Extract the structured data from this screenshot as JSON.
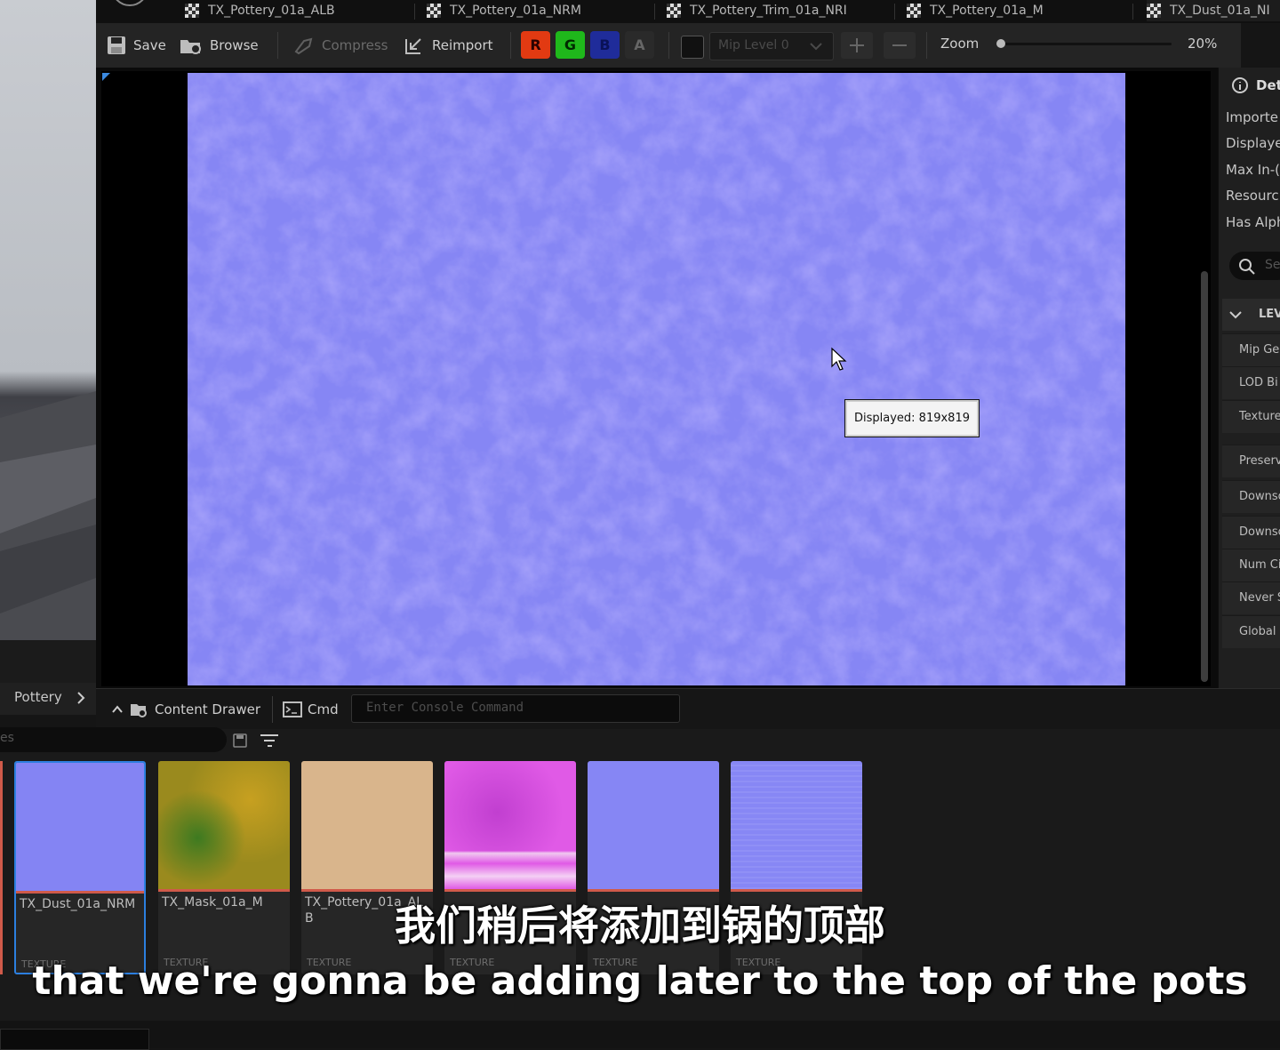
{
  "tabs": [
    {
      "label": "TX_Pottery_01a_ALB"
    },
    {
      "label": "TX_Pottery_01a_NRM"
    },
    {
      "label": "TX_Pottery_Trim_01a_NRI"
    },
    {
      "label": "TX_Pottery_01a_M"
    },
    {
      "label": "TX_Dust_01a_NI"
    }
  ],
  "toolbar": {
    "save": "Save",
    "browse": "Browse",
    "compress": "Compress",
    "reimport": "Reimport",
    "channels": [
      "R",
      "G",
      "B",
      "A"
    ],
    "mip_level": "Mip Level 0",
    "zoom_label": "Zoom",
    "zoom_value": "20%",
    "zoom_fraction": 0.02
  },
  "viewport": {
    "tooltip": "Displayed: 819x819"
  },
  "details": {
    "title": "Det",
    "rows": [
      "Importe",
      "Displaye",
      "Max In-(",
      "Resourc",
      "Has Alph"
    ],
    "search_placeholder": "Se",
    "section": "LEV",
    "lev_rows": [
      "Mip Ge",
      "LOD Bi",
      "Texture",
      "Preserv",
      "Downsc",
      "Downsc",
      "Num Ci",
      "Never S",
      "Global I"
    ]
  },
  "left_panel": {
    "folder": "Pottery"
  },
  "bottom_bar": {
    "content_drawer": "Content Drawer",
    "cmd": "Cmd",
    "console_placeholder": "Enter Console Command"
  },
  "content_browser": {
    "search_fragment": "es",
    "assets": [
      {
        "name": "TX_Dust_01a_NRM",
        "type": "TEXTURE",
        "selected": true,
        "color": "#8484f3"
      },
      {
        "name": "TX_Mask_01a_M",
        "type": "TEXTURE",
        "selected": false,
        "color": "#9a8a1e"
      },
      {
        "name": "TX_Pottery_01a_ALB",
        "type": "TEXTURE",
        "selected": false,
        "color": "#d9b58c"
      },
      {
        "name": "",
        "type": "TEXTURE",
        "selected": false,
        "color": "#e05ae6"
      },
      {
        "name": "",
        "type": "TEXTURE",
        "selected": false,
        "color": "#8686f4"
      },
      {
        "name": "",
        "type": "TEXTURE",
        "selected": false,
        "color": "#8787f5"
      }
    ]
  },
  "subtitles": {
    "chinese": "我们稍后将添加到锅的顶部",
    "english": "that we're gonna be adding later to the top of the pots"
  }
}
